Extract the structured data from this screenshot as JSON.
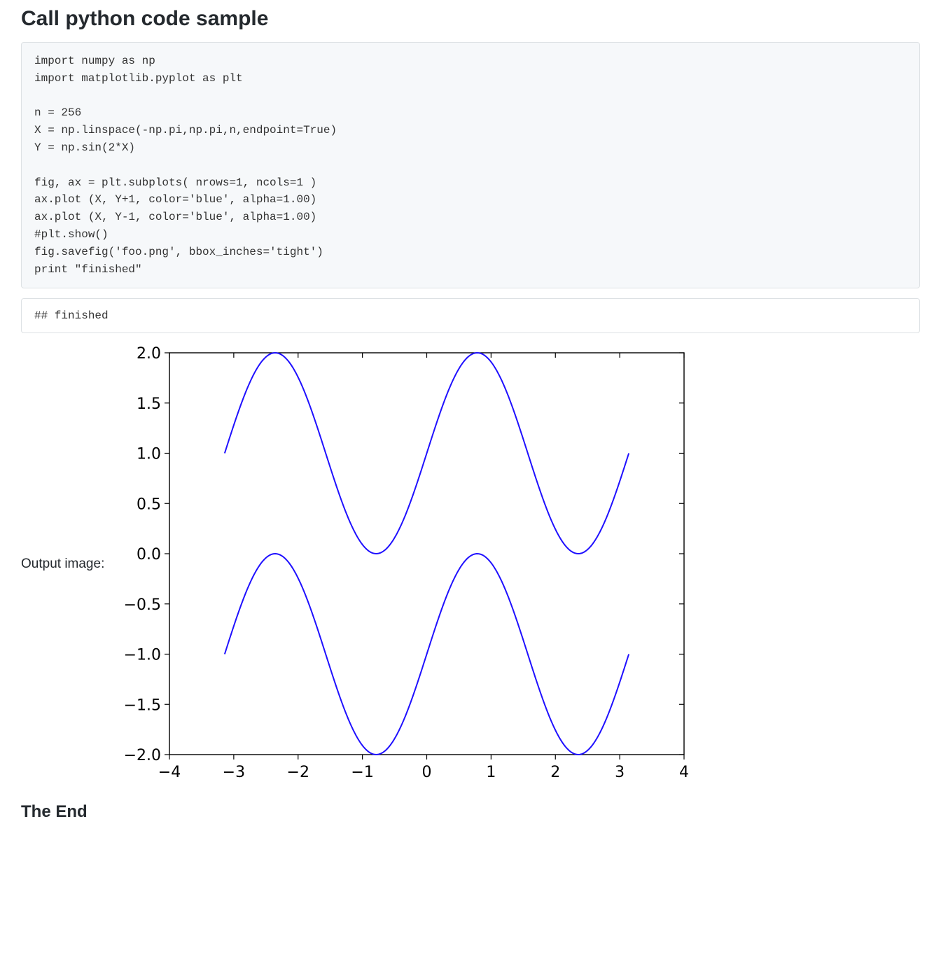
{
  "heading": "Call python code sample",
  "code": "import numpy as np\nimport matplotlib.pyplot as plt\n\nn = 256\nX = np.linspace(-np.pi,np.pi,n,endpoint=True)\nY = np.sin(2*X)\n\nfig, ax = plt.subplots( nrows=1, ncols=1 )\nax.plot (X, Y+1, color='blue', alpha=1.00)\nax.plot (X, Y-1, color='blue', alpha=1.00)\n#plt.show()\nfig.savefig('foo.png', bbox_inches='tight')\nprint \"finished\"",
  "output_text": "## finished",
  "output_image_label": "Output image:",
  "end_heading": "The End",
  "chart_data": {
    "type": "line",
    "title": "",
    "xlabel": "",
    "ylabel": "",
    "xlim": [
      -4,
      4
    ],
    "ylim": [
      -2.0,
      2.0
    ],
    "xticks": [
      -4,
      -3,
      -2,
      -1,
      0,
      1,
      2,
      3,
      4
    ],
    "yticks": [
      -2.0,
      -1.5,
      -1.0,
      -0.5,
      0.0,
      0.5,
      1.0,
      1.5,
      2.0
    ],
    "n_points": 256,
    "x_start": -3.1416,
    "x_end": 3.1416,
    "series": [
      {
        "name": "sin(2x)+1",
        "formula": "sin(2*x)+1",
        "offset": 1,
        "color": "#1f10ff"
      },
      {
        "name": "sin(2x)-1",
        "formula": "sin(2*x)-1",
        "offset": -1,
        "color": "#1f10ff"
      }
    ]
  }
}
